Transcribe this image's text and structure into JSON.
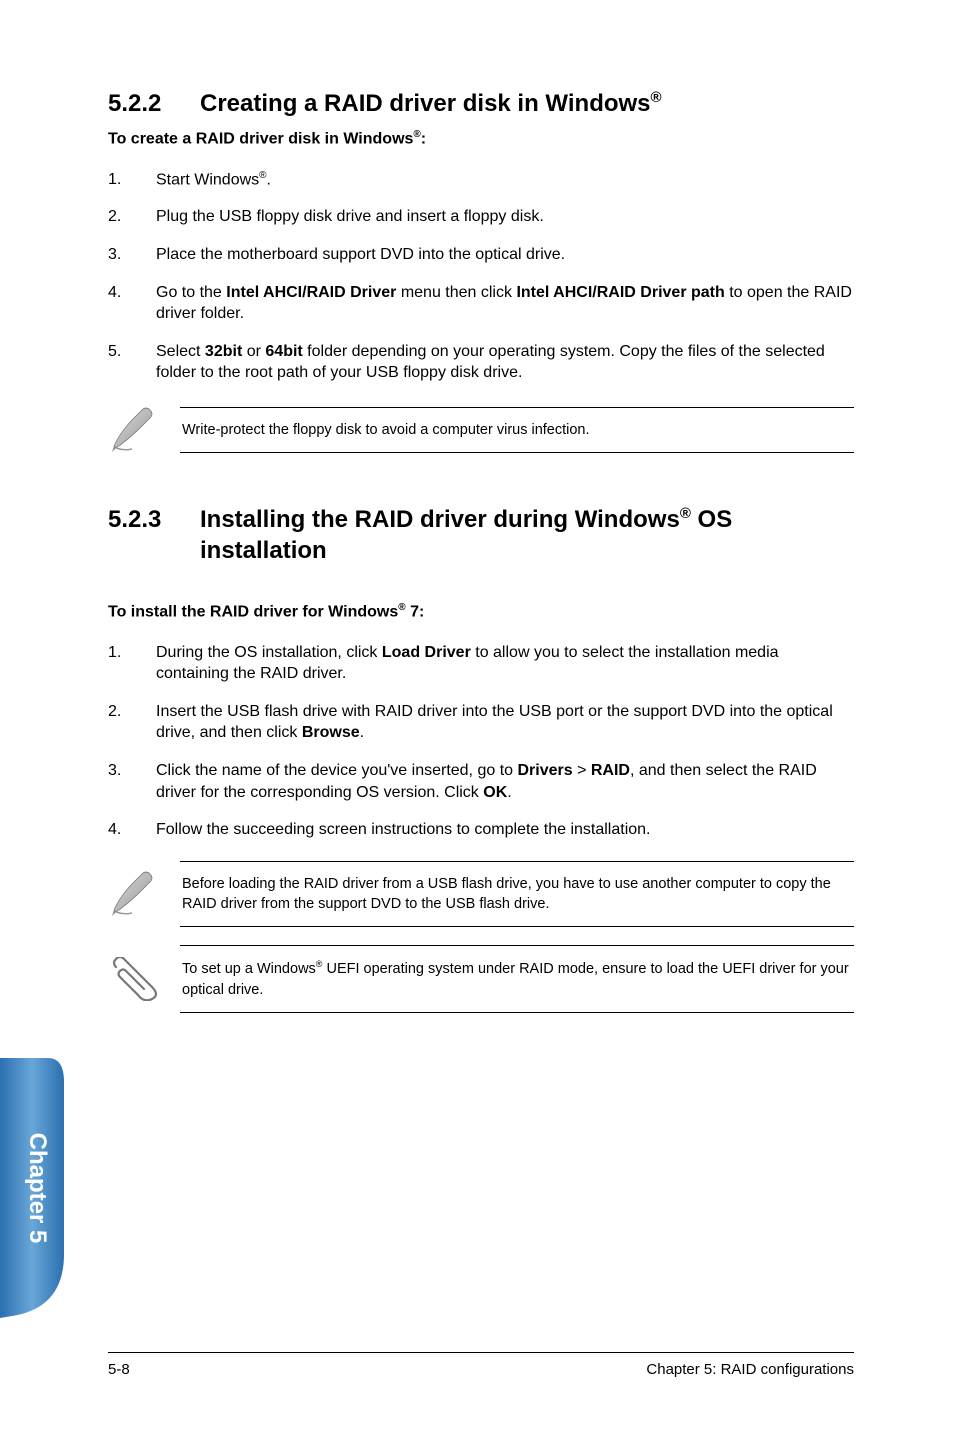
{
  "section_522": {
    "number": "5.2.2",
    "title_before_reg": "Creating a RAID driver disk in Windows",
    "sub_heading_before_reg": "To create a RAID driver disk in Windows",
    "sub_heading_after_reg": ":",
    "steps": [
      {
        "pre": "Start Windows",
        "has_reg": true,
        "post": "."
      },
      {
        "pre": "Plug the USB floppy disk drive and insert a floppy disk.",
        "has_reg": false,
        "post": ""
      },
      {
        "pre": "Place the motherboard support DVD into the optical drive.",
        "has_reg": false,
        "post": ""
      },
      {
        "pre": "Go to the ",
        "bold1": "Intel AHCI/RAID Driver",
        "mid1": " menu then click ",
        "bold2": "Intel AHCI/RAID Driver path",
        "post1": " to open the RAID driver folder."
      },
      {
        "pre": "Select ",
        "bold1": "32bit",
        "mid1": " or ",
        "bold2": "64bit",
        "post1": " folder depending on your operating system. Copy the files of the selected folder to the root path of your USB floppy disk drive."
      }
    ],
    "note": "Write-protect the floppy disk to avoid a computer virus infection."
  },
  "section_523": {
    "number": "5.2.3",
    "title_line1_before_reg": "Installing the RAID driver during Windows",
    "title_line1_after_reg": " OS",
    "title_line2": "installation",
    "sub_heading_before_reg": "To install the RAID driver for Windows",
    "sub_heading_after_reg": " 7:",
    "steps": [
      {
        "pre": "During the OS installation, click ",
        "bold1": "Load Driver",
        "post1": " to allow you to select the installation media containing the RAID driver."
      },
      {
        "pre": "Insert the USB flash drive with RAID driver into the USB port or the support DVD into the optical drive, and then click ",
        "bold1": "Browse",
        "post1": "."
      },
      {
        "pre": "Click the name of the device you've inserted, go to ",
        "bold1": "Drivers",
        "mid1": " > ",
        "bold2": "RAID",
        "mid2": ", and then select the RAID driver for the corresponding OS version. Click ",
        "bold3": "OK",
        "post1": "."
      },
      {
        "pre": "Follow the succeeding screen instructions to complete the installation."
      }
    ],
    "note1": "Before loading the RAID driver from a USB flash drive, you have to use another computer to copy the RAID driver from the support DVD to the USB flash drive.",
    "note2_before_reg": "To set up a Windows",
    "note2_after_reg": " UEFI operating system under RAID mode, ensure to load the UEFI driver for your optical drive."
  },
  "spine_text": "Chapter 5",
  "footer": {
    "left": "5-8",
    "right": "Chapter 5: RAID configurations"
  },
  "icons": {
    "pencil": "pencil-note-icon",
    "paperclip": "paperclip-icon"
  }
}
